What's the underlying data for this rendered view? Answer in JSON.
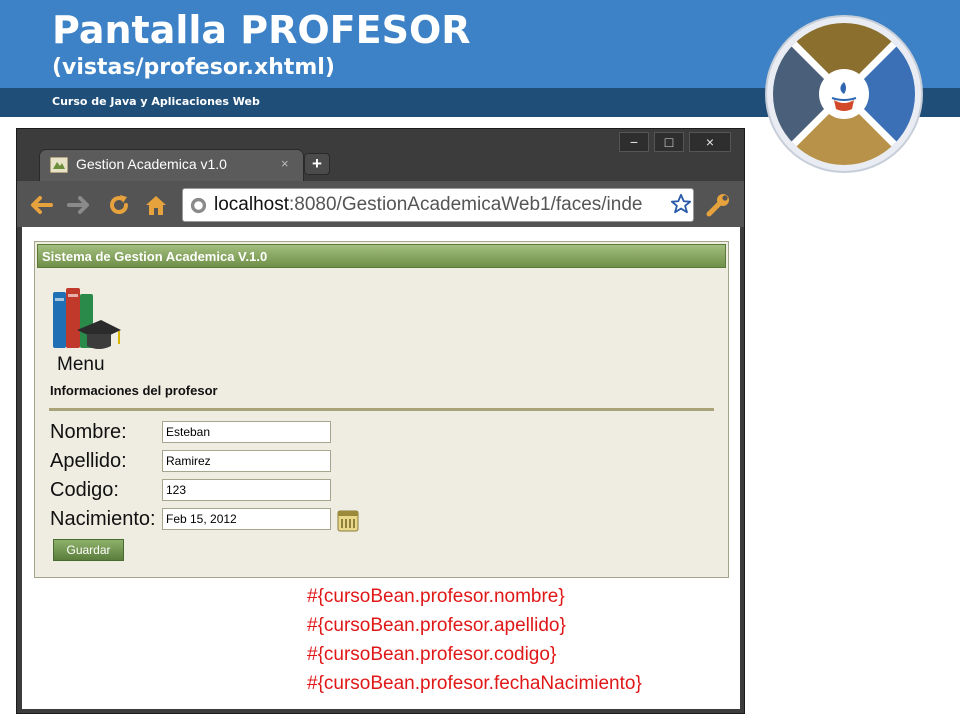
{
  "slide": {
    "title": "Pantalla PROFESOR",
    "subtitle": "(vistas/profesor.xhtml)",
    "course": "Curso de Java y Aplicaciones Web"
  },
  "browser": {
    "tab_title": "Gestion Academica v1.0",
    "tab_close": "×",
    "new_tab": "+",
    "url_host": "localhost",
    "url_rest": ":8080/GestionAcademicaWeb1/faces/inde",
    "window_buttons": [
      "−",
      "□",
      "×"
    ]
  },
  "page": {
    "panel_title": "Sistema de Gestion Academica V.1.0",
    "menu_label": "Menu",
    "section_title": "Informaciones del profesor",
    "fields": [
      {
        "label": "Nombre:",
        "value": "Esteban"
      },
      {
        "label": "Apellido:",
        "value": "Ramirez"
      },
      {
        "label": "Codigo:",
        "value": "123"
      },
      {
        "label": "Nacimiento:",
        "value": "Feb 15, 2012"
      }
    ],
    "save_button": "Guardar",
    "expressions": [
      "#{cursoBean.profesor.nombre}",
      "#{cursoBean.profesor.apellido}",
      "#{cursoBean.profesor.codigo}",
      "#{cursoBean.profesor.fechaNacimiento}"
    ]
  },
  "icons": [
    "java-logo-icon",
    "favicon-icon",
    "back-icon",
    "forward-icon",
    "reload-icon",
    "home-icon",
    "globe-icon",
    "star-icon",
    "wrench-icon",
    "books-icon",
    "calendar-icon"
  ],
  "colors": {
    "header_blue": "#3d82c6",
    "header_dark": "#1f4e79",
    "panel_green": "#6f9048",
    "expression_red": "#e01717"
  }
}
